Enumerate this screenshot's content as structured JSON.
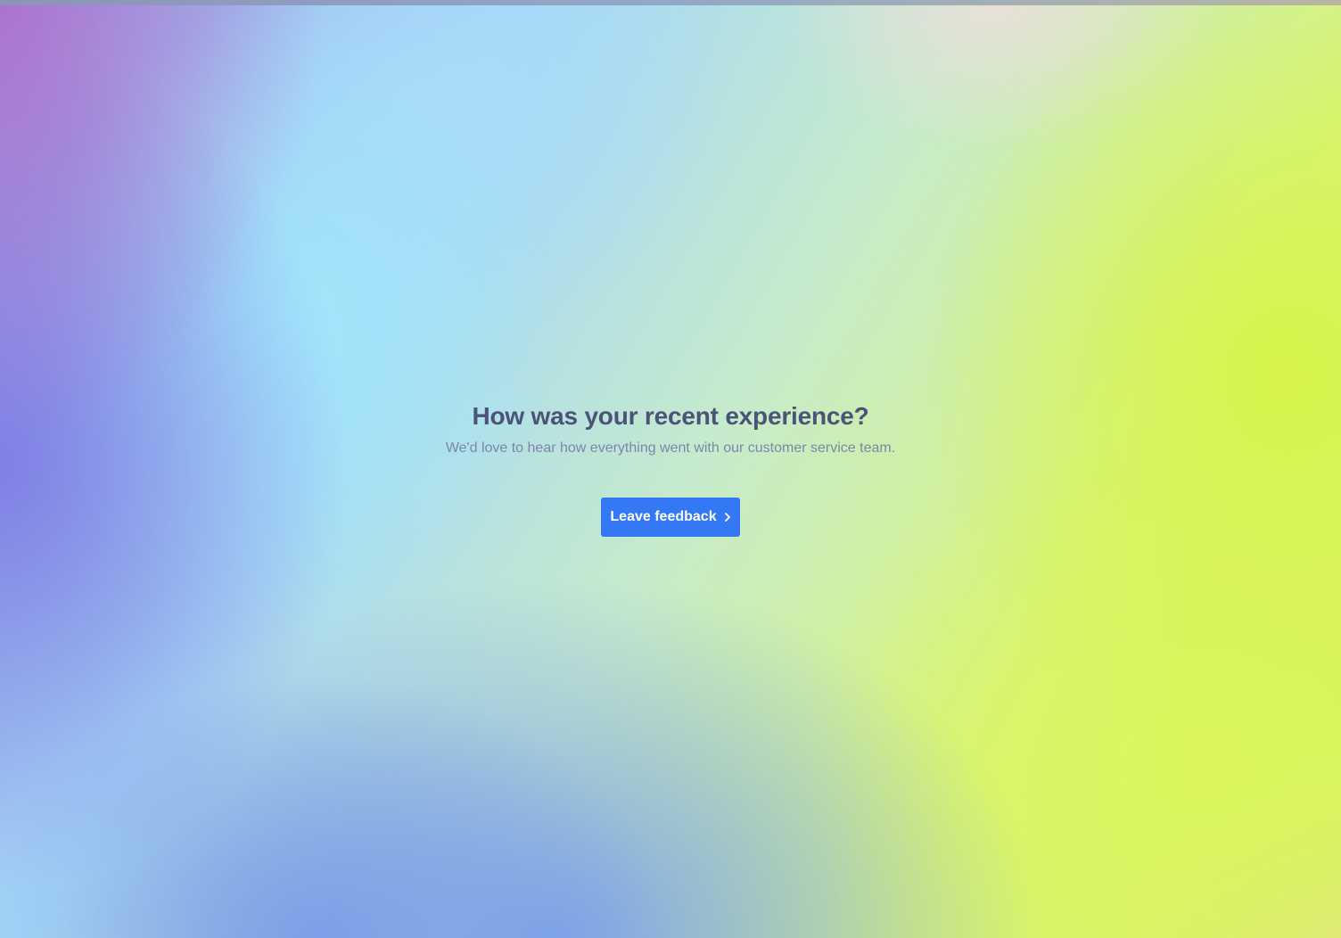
{
  "hero": {
    "title": "How was your recent experience?",
    "subtitle": "We'd love to hear how everything went with our customer service team."
  },
  "cta": {
    "label": "Leave feedback",
    "icon": "chevron-right-icon"
  },
  "colors": {
    "title_text": "#4b5478",
    "subtitle_text": "#7d86ab",
    "button_background": "#3478f6",
    "button_text": "#ffffff"
  }
}
